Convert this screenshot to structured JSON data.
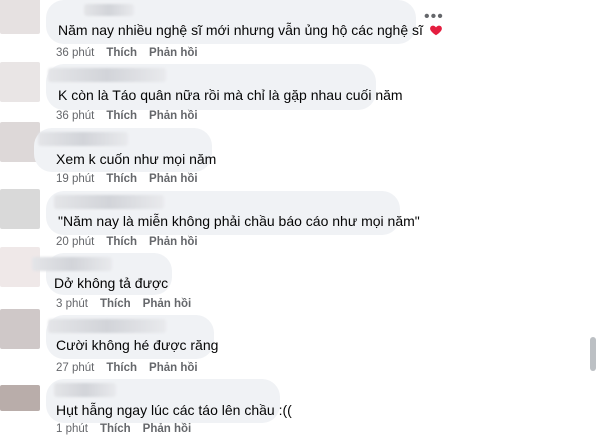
{
  "comments": [
    {
      "text": "Năm nay nhiều nghệ sĩ mới nhưng vẫn ủng hộ các nghệ sĩ",
      "heart": true,
      "time": "36 phút",
      "like": "Thích",
      "reply": "Phản hồi"
    },
    {
      "text": "K còn là Táo quân nữa rồi mà chỉ là gặp nhau cuối năm",
      "time": "36 phút",
      "like": "Thích",
      "reply": "Phản hồi"
    },
    {
      "text": "Xem k cuốn như mọi năm",
      "time": "19 phút",
      "like": "Thích",
      "reply": "Phản hồi"
    },
    {
      "text": "\"Năm nay là miễn không phải chầu báo cáo như mọi năm\"",
      "time": "20 phút",
      "like": "Thích",
      "reply": "Phản hồi"
    },
    {
      "text": "Dở không tả được",
      "time": "3 phút",
      "like": "Thích",
      "reply": "Phản hồi"
    },
    {
      "text": "Cười không hé được răng",
      "time": "27 phút",
      "like": "Thích",
      "reply": "Phản hồi"
    },
    {
      "text": "Hụt hẫng ngay lúc các táo lên chầu :((",
      "time": "1 phút",
      "like": "Thích",
      "reply": "Phản hồi"
    }
  ],
  "more_icon": "more-horizontal-icon",
  "colors": {
    "bubble": "#f0f2f5",
    "meta": "#65676b",
    "heart": "#e41e3f"
  }
}
